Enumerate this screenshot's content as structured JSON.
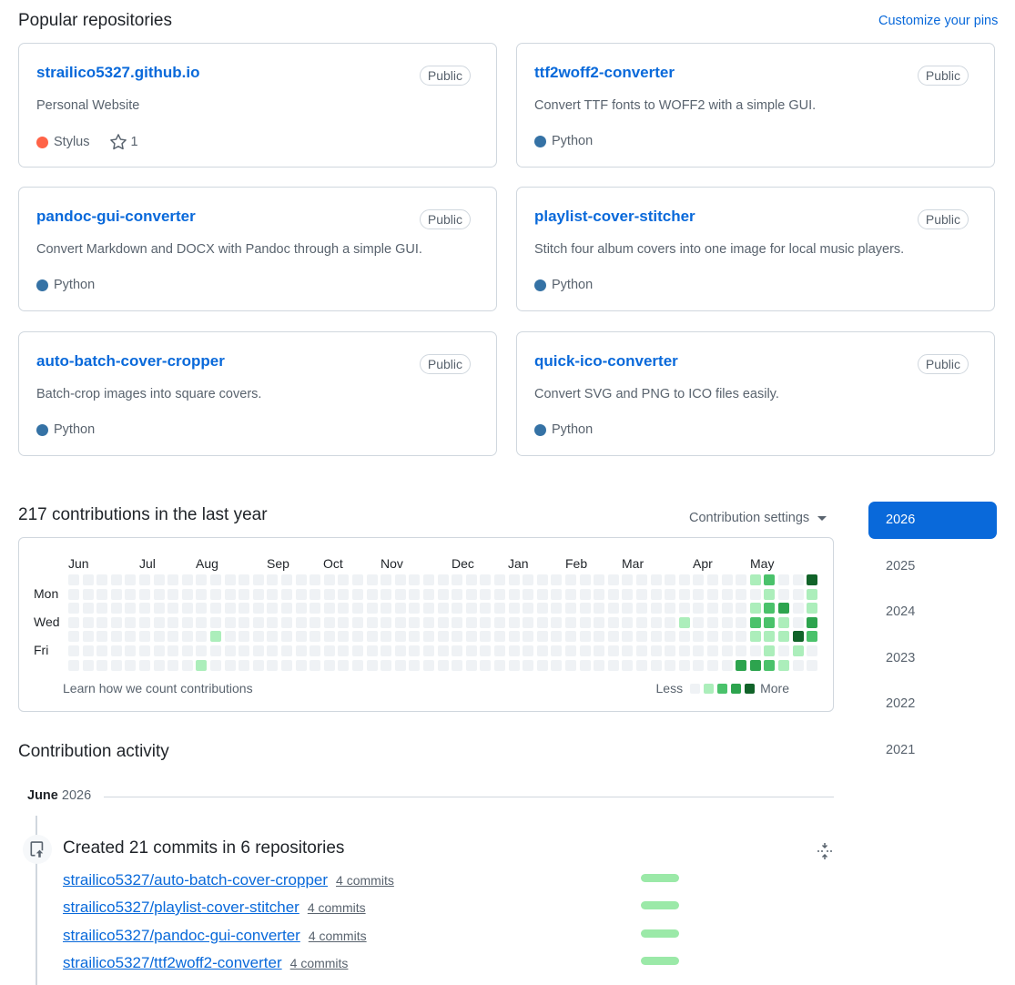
{
  "popular": {
    "title": "Popular repositories",
    "customize_label": "Customize your pins",
    "repos": [
      {
        "name": "strailico5327.github.io",
        "visibility": "Public",
        "description": "Personal Website",
        "language": "Stylus",
        "language_color": "#ff6347",
        "stars": "1"
      },
      {
        "name": "ttf2woff2-converter",
        "visibility": "Public",
        "description": "Convert TTF fonts to WOFF2 with a simple GUI.",
        "language": "Python",
        "language_color": "#3572A5"
      },
      {
        "name": "pandoc-gui-converter",
        "visibility": "Public",
        "description": "Convert Markdown and DOCX with Pandoc through a simple GUI.",
        "language": "Python",
        "language_color": "#3572A5"
      },
      {
        "name": "playlist-cover-stitcher",
        "visibility": "Public",
        "description": "Stitch four album covers into one image for local music players.",
        "language": "Python",
        "language_color": "#3572A5"
      },
      {
        "name": "auto-batch-cover-cropper",
        "visibility": "Public",
        "description": "Batch-crop images into square covers.",
        "language": "Python",
        "language_color": "#3572A5"
      },
      {
        "name": "quick-ico-converter",
        "visibility": "Public",
        "description": "Convert SVG and PNG to ICO files easily.",
        "language": "Python",
        "language_color": "#3572A5"
      }
    ]
  },
  "contributions": {
    "title": "217 contributions in the last year",
    "settings_label": "Contribution settings",
    "months": [
      "Jun",
      "Jul",
      "Aug",
      "Sep",
      "Oct",
      "Nov",
      "Dec",
      "Jan",
      "Feb",
      "Mar",
      "Apr",
      "May"
    ],
    "days": [
      "Mon",
      "Wed",
      "Fri"
    ],
    "learn_label": "Learn how we count contributions",
    "legend_less": "Less",
    "legend_more": "More",
    "level_colors": [
      "#eff2f5",
      "#aceebb",
      "#4ac26b",
      "#2da44e",
      "#116329"
    ],
    "grid_weeks": 53,
    "active_cells": [
      {
        "week": 10,
        "day": 4,
        "level": 1
      },
      {
        "week": 9,
        "day": 6,
        "level": 1
      },
      {
        "week": 43,
        "day": 3,
        "level": 1
      },
      {
        "week": 47,
        "day": 6,
        "level": 3
      },
      {
        "week": 48,
        "day": 0,
        "level": 1
      },
      {
        "week": 48,
        "day": 2,
        "level": 1
      },
      {
        "week": 48,
        "day": 3,
        "level": 2
      },
      {
        "week": 48,
        "day": 4,
        "level": 1
      },
      {
        "week": 48,
        "day": 6,
        "level": 3
      },
      {
        "week": 49,
        "day": 0,
        "level": 2
      },
      {
        "week": 49,
        "day": 1,
        "level": 1
      },
      {
        "week": 49,
        "day": 2,
        "level": 2
      },
      {
        "week": 49,
        "day": 3,
        "level": 2
      },
      {
        "week": 49,
        "day": 4,
        "level": 1
      },
      {
        "week": 49,
        "day": 5,
        "level": 1
      },
      {
        "week": 49,
        "day": 6,
        "level": 2
      },
      {
        "week": 50,
        "day": 2,
        "level": 3
      },
      {
        "week": 50,
        "day": 3,
        "level": 1
      },
      {
        "week": 50,
        "day": 4,
        "level": 1
      },
      {
        "week": 50,
        "day": 6,
        "level": 1
      },
      {
        "week": 51,
        "day": 4,
        "level": 4
      },
      {
        "week": 51,
        "day": 5,
        "level": 1
      },
      {
        "week": 52,
        "day": 0,
        "level": 4
      },
      {
        "week": 52,
        "day": 1,
        "level": 1
      },
      {
        "week": 52,
        "day": 2,
        "level": 1
      },
      {
        "week": 52,
        "day": 3,
        "level": 3
      },
      {
        "week": 52,
        "day": 4,
        "level": 2
      },
      {
        "week": 51,
        "day": 6,
        "level": 0
      }
    ]
  },
  "years": [
    "2026",
    "2025",
    "2024",
    "2023",
    "2022",
    "2021"
  ],
  "active_year": "2026",
  "activity": {
    "title": "Contribution activity",
    "month_label": "June",
    "year_label": "2026",
    "summary": "Created 21 commits in 6 repositories",
    "rows": [
      {
        "repo": "strailico5327/auto-batch-cover-cropper",
        "count": "4 commits"
      },
      {
        "repo": "strailico5327/playlist-cover-stitcher",
        "count": "4 commits"
      },
      {
        "repo": "strailico5327/pandoc-gui-converter",
        "count": "4 commits"
      },
      {
        "repo": "strailico5327/ttf2woff2-converter",
        "count": "4 commits"
      }
    ]
  }
}
